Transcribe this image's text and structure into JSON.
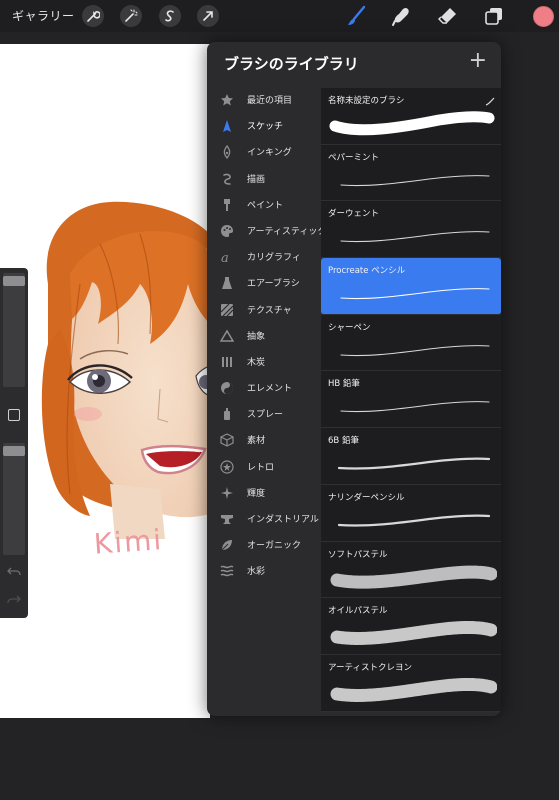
{
  "toolbar": {
    "gallery_label": "ギャラリー",
    "left_tools": [
      "wrench-icon",
      "magic-wand-icon",
      "selection-icon",
      "transform-arrow-icon"
    ],
    "right_tools": [
      "brush-icon",
      "smudge-icon",
      "eraser-icon",
      "layers-icon"
    ],
    "active_tool": "brush-icon",
    "accent_color": "#3a7bf0",
    "current_color": "#ef7f86"
  },
  "canvas": {
    "signature_text": "Kimi"
  },
  "library": {
    "title": "ブラシのライブラリ",
    "add_label": "+",
    "categories": [
      {
        "label": "最近の項目",
        "icon": "star-icon"
      },
      {
        "label": "スケッチ",
        "icon": "pencil-tip-icon"
      },
      {
        "label": "インキング",
        "icon": "ink-pen-icon"
      },
      {
        "label": "描画",
        "icon": "swirl-icon"
      },
      {
        "label": "ペイント",
        "icon": "paint-brush-icon"
      },
      {
        "label": "アーティスティック",
        "icon": "palette-icon"
      },
      {
        "label": "カリグラフィ",
        "icon": "calligraphy-icon"
      },
      {
        "label": "エアーブラシ",
        "icon": "airbrush-icon"
      },
      {
        "label": "テクスチャ",
        "icon": "texture-icon"
      },
      {
        "label": "抽象",
        "icon": "triangle-icon"
      },
      {
        "label": "木炭",
        "icon": "charcoal-icon"
      },
      {
        "label": "エレメント",
        "icon": "yin-yang-icon"
      },
      {
        "label": "スプレー",
        "icon": "spray-can-icon"
      },
      {
        "label": "素材",
        "icon": "cube-icon"
      },
      {
        "label": "レトロ",
        "icon": "retro-star-icon"
      },
      {
        "label": "輝度",
        "icon": "sparkle-icon"
      },
      {
        "label": "インダストリアル",
        "icon": "anvil-icon"
      },
      {
        "label": "オーガニック",
        "icon": "leaf-icon"
      },
      {
        "label": "水彩",
        "icon": "waves-icon"
      }
    ],
    "active_category": 1,
    "brushes": [
      {
        "name": "名称未設定のブラシ",
        "style": "thick"
      },
      {
        "name": "ペパーミント",
        "style": "thin"
      },
      {
        "name": "ダーウェント",
        "style": "thin"
      },
      {
        "name": "Procreate ペンシル",
        "style": "thin"
      },
      {
        "name": "シャーペン",
        "style": "thin"
      },
      {
        "name": "HB 鉛筆",
        "style": "thin"
      },
      {
        "name": "6B 鉛筆",
        "style": "medium"
      },
      {
        "name": "ナリンダーペンシル",
        "style": "medium"
      },
      {
        "name": "ソフトパステル",
        "style": "chalk"
      },
      {
        "name": "オイルパステル",
        "style": "grainy"
      },
      {
        "name": "アーティストクレヨン",
        "style": "grainy"
      }
    ],
    "selected_brush": 3
  }
}
